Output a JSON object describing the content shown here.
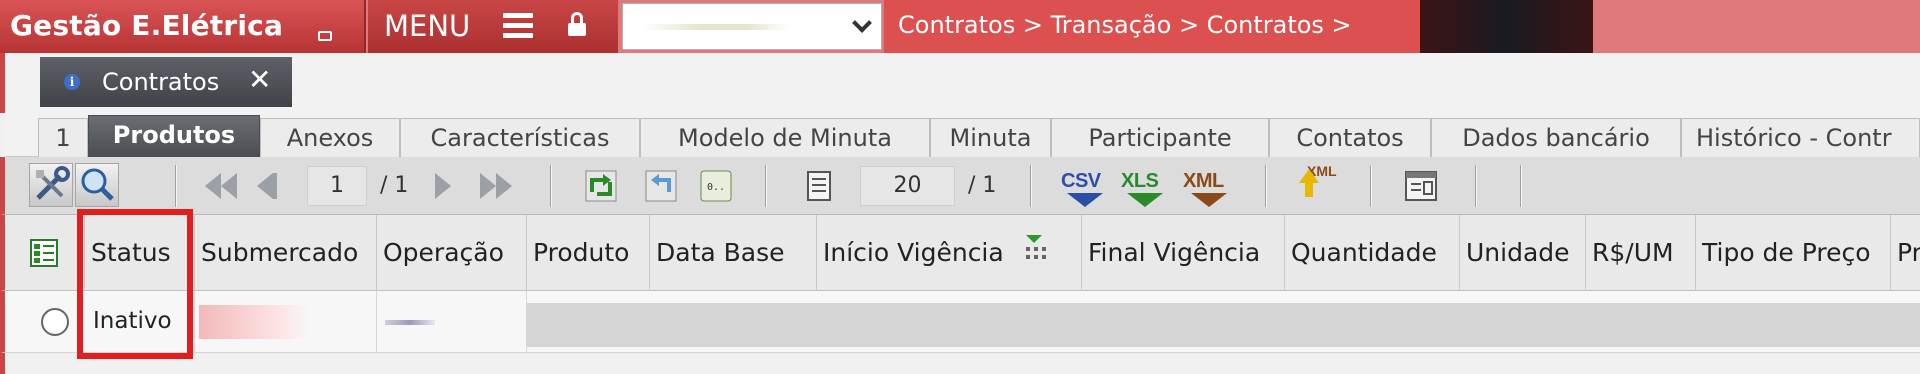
{
  "app": {
    "title": "Gestão E.Elétrica",
    "menu_label": "MENU",
    "breadcrumb": "Contratos > Transação > Contratos >"
  },
  "doc_tab": {
    "label": "Contratos"
  },
  "subtabs": [
    "1",
    "Produtos",
    "Anexos",
    "Características",
    "Modelo de Minuta",
    "Minuta",
    "Participante",
    "Contatos",
    "Dados bancário",
    "Histórico - Contr"
  ],
  "active_subtab": "Produtos",
  "toolbar": {
    "page_current": "1",
    "page_total": "/ 1",
    "page_size": "20",
    "page_size_total": "/ 1",
    "export_csv": "CSV",
    "export_xls": "XLS",
    "export_xml": "XML",
    "import_xml": "XML"
  },
  "grid": {
    "columns": [
      "Status",
      "Submercado",
      "Operação",
      "Produto",
      "Data Base",
      "Início Vigência",
      "Final Vigência",
      "Quantidade",
      "Unidade",
      "R$/UM",
      "Tipo de Preço",
      "Pr"
    ],
    "rows": [
      {
        "status": "Inativo"
      }
    ]
  },
  "colors": {
    "brand": "#c94646",
    "highlight": "#e11d1d",
    "csv": "#2b4fa8",
    "xls": "#2a8a2a",
    "xml": "#8a4a1a"
  }
}
